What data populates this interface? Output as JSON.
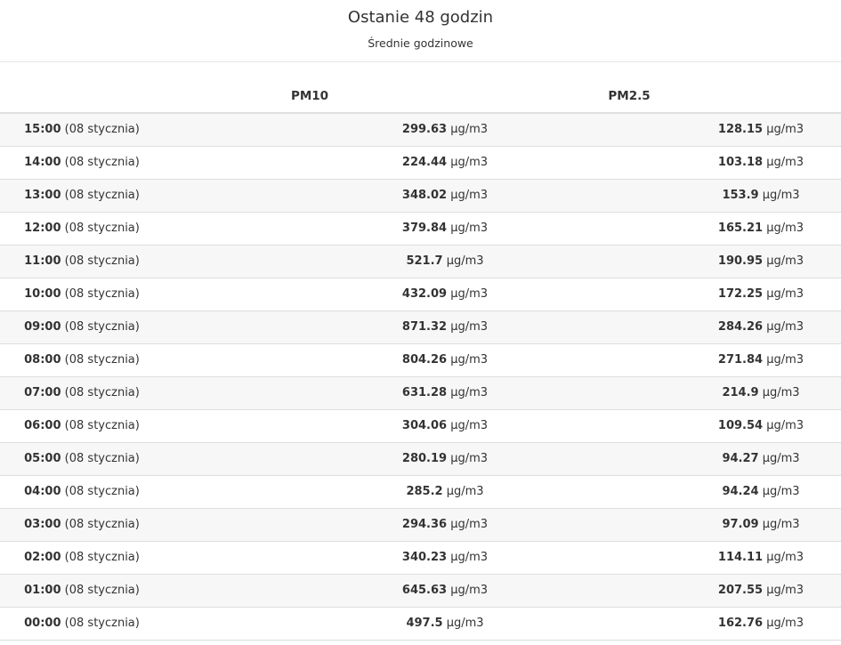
{
  "header": {
    "title": "Ostanie 48 godzin",
    "subtitle": "Średnie godzinowe"
  },
  "columns": {
    "pm10": "PM10",
    "pm25": "PM2.5"
  },
  "rows": [
    {
      "time": "15:00",
      "date": "(08 stycznia)",
      "pm10": "299.63",
      "pm10_unit": "µg/m3",
      "pm25": "128.15",
      "pm25_unit": "µg/m3"
    },
    {
      "time": "14:00",
      "date": "(08 stycznia)",
      "pm10": "224.44",
      "pm10_unit": "µg/m3",
      "pm25": "103.18",
      "pm25_unit": "µg/m3"
    },
    {
      "time": "13:00",
      "date": "(08 stycznia)",
      "pm10": "348.02",
      "pm10_unit": "µg/m3",
      "pm25": "153.9",
      "pm25_unit": "µg/m3"
    },
    {
      "time": "12:00",
      "date": "(08 stycznia)",
      "pm10": "379.84",
      "pm10_unit": "µg/m3",
      "pm25": "165.21",
      "pm25_unit": "µg/m3"
    },
    {
      "time": "11:00",
      "date": "(08 stycznia)",
      "pm10": "521.7",
      "pm10_unit": "µg/m3",
      "pm25": "190.95",
      "pm25_unit": "µg/m3"
    },
    {
      "time": "10:00",
      "date": "(08 stycznia)",
      "pm10": "432.09",
      "pm10_unit": "µg/m3",
      "pm25": "172.25",
      "pm25_unit": "µg/m3"
    },
    {
      "time": "09:00",
      "date": "(08 stycznia)",
      "pm10": "871.32",
      "pm10_unit": "µg/m3",
      "pm25": "284.26",
      "pm25_unit": "µg/m3"
    },
    {
      "time": "08:00",
      "date": "(08 stycznia)",
      "pm10": "804.26",
      "pm10_unit": "µg/m3",
      "pm25": "271.84",
      "pm25_unit": "µg/m3"
    },
    {
      "time": "07:00",
      "date": "(08 stycznia)",
      "pm10": "631.28",
      "pm10_unit": "µg/m3",
      "pm25": "214.9",
      "pm25_unit": "µg/m3"
    },
    {
      "time": "06:00",
      "date": "(08 stycznia)",
      "pm10": "304.06",
      "pm10_unit": "µg/m3",
      "pm25": "109.54",
      "pm25_unit": "µg/m3"
    },
    {
      "time": "05:00",
      "date": "(08 stycznia)",
      "pm10": "280.19",
      "pm10_unit": "µg/m3",
      "pm25": "94.27",
      "pm25_unit": "µg/m3"
    },
    {
      "time": "04:00",
      "date": "(08 stycznia)",
      "pm10": "285.2",
      "pm10_unit": "µg/m3",
      "pm25": "94.24",
      "pm25_unit": "µg/m3"
    },
    {
      "time": "03:00",
      "date": "(08 stycznia)",
      "pm10": "294.36",
      "pm10_unit": "µg/m3",
      "pm25": "97.09",
      "pm25_unit": "µg/m3"
    },
    {
      "time": "02:00",
      "date": "(08 stycznia)",
      "pm10": "340.23",
      "pm10_unit": "µg/m3",
      "pm25": "114.11",
      "pm25_unit": "µg/m3"
    },
    {
      "time": "01:00",
      "date": "(08 stycznia)",
      "pm10": "645.63",
      "pm10_unit": "µg/m3",
      "pm25": "207.55",
      "pm25_unit": "µg/m3"
    },
    {
      "time": "00:00",
      "date": "(08 stycznia)",
      "pm10": "497.5",
      "pm10_unit": "µg/m3",
      "pm25": "162.76",
      "pm25_unit": "µg/m3"
    }
  ]
}
